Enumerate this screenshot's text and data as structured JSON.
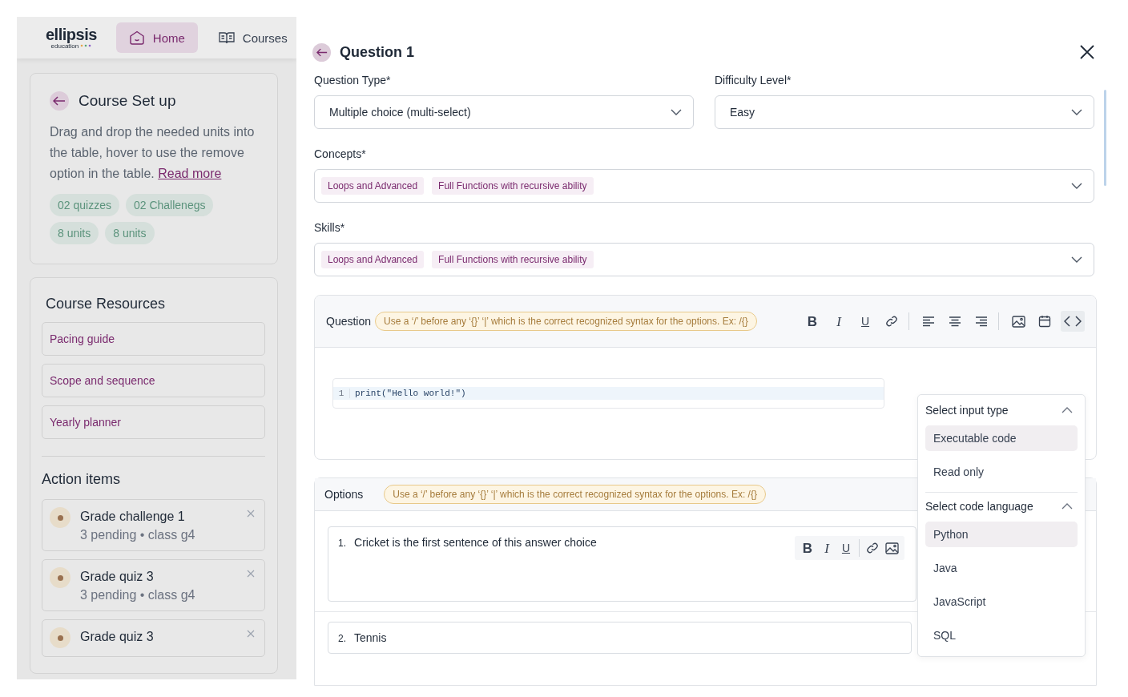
{
  "app_header": {
    "logo": {
      "wordmark": "ellipsis",
      "tagline": "education"
    },
    "nav": [
      {
        "label": "Home",
        "selected": true,
        "kind": "home"
      },
      {
        "label": "Courses",
        "selected": false,
        "kind": "book"
      }
    ]
  },
  "course_setup": {
    "title": "Course Set up",
    "description": "Drag and drop the needed units into the table, hover to use the remove option in the table.",
    "link": "Read more",
    "tags": [
      "02 quizzes",
      "02 Challenegs",
      "8 units",
      "8 units"
    ]
  },
  "course_resources": {
    "title": "Course Resources",
    "links": [
      "Pacing guide",
      "Scope and sequence",
      "Yearly planner"
    ]
  },
  "action_items": {
    "title": "Action items",
    "items": [
      {
        "title": "Grade challenge 1",
        "meta": "3 pending • class g4"
      },
      {
        "title": "Grade quiz 3",
        "meta": "3 pending • class g4"
      },
      {
        "title": "Grade quiz 3"
      }
    ]
  },
  "question_panel": {
    "title": "Question 1",
    "fields": [
      {
        "label": "Question Type*",
        "value": "Multiple choice (multi-select)"
      },
      {
        "label": "Difficulty Level*",
        "value": "Easy"
      }
    ],
    "tag_fields": [
      {
        "label": "Concepts*",
        "tags": [
          "Loops and Advanced",
          "Full Functions with recursive ability"
        ]
      },
      {
        "label": "Skills*",
        "tags": [
          "Loops and Advanced",
          "Full Functions with recursive ability"
        ]
      }
    ],
    "question": {
      "label": "Question",
      "hint": "Use a ‘/’ before any ‘{}’ ‘|’ which is the correct recognized syntax for the options. Ex: /{}",
      "tools": [
        {
          "kind": "bold",
          "glyph": "B",
          "active": false
        },
        {
          "kind": "italic",
          "glyph": "I",
          "active": false
        },
        {
          "kind": "underline",
          "glyph": "U",
          "active": false
        },
        {
          "kind": "link",
          "active": false
        },
        {
          "kind": "separator"
        },
        {
          "kind": "align-left",
          "active": false
        },
        {
          "kind": "align-center",
          "active": false
        },
        {
          "kind": "align-right",
          "active": false
        },
        {
          "kind": "separator"
        },
        {
          "kind": "image",
          "active": false
        },
        {
          "kind": "calendar",
          "active": false
        },
        {
          "kind": "code",
          "active": true
        }
      ],
      "code": [
        {
          "line": "1",
          "text": "print(\"Hello world!\")"
        }
      ]
    },
    "dropdown": {
      "sections": [
        {
          "title": "Select input type",
          "expanded": true,
          "options": [
            {
              "label": "Executable code",
              "selected": true
            },
            {
              "label": "Read only",
              "selected": false
            }
          ]
        },
        {
          "title": "Select code language",
          "expanded": true,
          "options": [
            {
              "label": "Python",
              "selected": true
            },
            {
              "label": "Java",
              "selected": false
            },
            {
              "label": "JavaScript",
              "selected": false
            },
            {
              "label": "SQL",
              "selected": false
            }
          ]
        }
      ]
    },
    "options": {
      "label": "Options",
      "hint": "Use a ‘/’ before any ‘{}’ ‘|’ which is the correct recognized syntax for the options. Ex: /{}",
      "items": [
        {
          "number": "1.",
          "text": "Cricket is the first sentence of this answer choice",
          "focused": true
        },
        {
          "number": "2.",
          "text": "Tennis",
          "focused": false
        }
      ],
      "mini_tools": [
        {
          "kind": "bold",
          "glyph": "B"
        },
        {
          "kind": "italic",
          "glyph": "I"
        },
        {
          "kind": "underline",
          "glyph": "U"
        },
        {
          "kind": "separator"
        },
        {
          "kind": "link"
        },
        {
          "kind": "image"
        }
      ]
    }
  }
}
